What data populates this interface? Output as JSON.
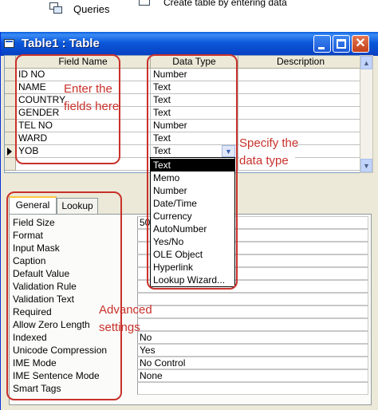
{
  "background": {
    "queries_label": "Queries",
    "create_label": "Create table by entering data"
  },
  "window": {
    "title": "Table1 : Table",
    "close_glyph": "✕"
  },
  "grid": {
    "headers": {
      "field_name": "Field Name",
      "data_type": "Data Type",
      "description": "Description"
    },
    "rows": [
      {
        "field": "ID NO",
        "type": "Number",
        "desc": ""
      },
      {
        "field": "NAME",
        "type": "Text",
        "desc": ""
      },
      {
        "field": "COUNTRY",
        "type": "Text",
        "desc": ""
      },
      {
        "field": "GENDER",
        "type": "Text",
        "desc": ""
      },
      {
        "field": "TEL NO",
        "type": "Number",
        "desc": ""
      },
      {
        "field": "WARD",
        "type": "Text",
        "desc": ""
      },
      {
        "field": "YOB",
        "type": "Text",
        "desc": ""
      }
    ],
    "dropdown_glyph": "▼",
    "scroll_up_glyph": "▲",
    "scroll_down_glyph": "▼"
  },
  "dropdown": {
    "options": [
      "Text",
      "Memo",
      "Number",
      "Date/Time",
      "Currency",
      "AutoNumber",
      "Yes/No",
      "OLE Object",
      "Hyperlink",
      "Lookup Wizard..."
    ],
    "selected": "Text"
  },
  "properties": {
    "tabs": {
      "general": "General",
      "lookup": "Lookup"
    },
    "items": [
      {
        "label": "Field Size",
        "value": "50"
      },
      {
        "label": "Format",
        "value": ""
      },
      {
        "label": "Input Mask",
        "value": ""
      },
      {
        "label": "Caption",
        "value": ""
      },
      {
        "label": "Default Value",
        "value": ""
      },
      {
        "label": "Validation Rule",
        "value": ""
      },
      {
        "label": "Validation Text",
        "value": ""
      },
      {
        "label": "Required",
        "value": ""
      },
      {
        "label": "Allow Zero Length",
        "value": ""
      },
      {
        "label": "Indexed",
        "value": "No"
      },
      {
        "label": "Unicode Compression",
        "value": "Yes"
      },
      {
        "label": "IME Mode",
        "value": "No Control"
      },
      {
        "label": "IME Sentence Mode",
        "value": "None"
      },
      {
        "label": "Smart Tags",
        "value": ""
      }
    ]
  },
  "annotations": {
    "fields_line1": "Enter the",
    "fields_line2": "fields here",
    "types_line1": "Specify the",
    "types_line2": "data type",
    "adv_line1": "Advanced",
    "adv_line2": "settings"
  },
  "colors": {
    "titlebar": "#0b58d9",
    "annotation": "#c8312b",
    "selected_option_bg": "#000000"
  }
}
